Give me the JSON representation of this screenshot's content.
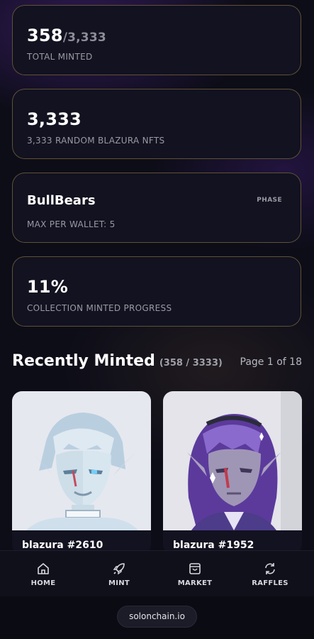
{
  "stats": {
    "total_minted": {
      "value": "358",
      "total": "/3,333",
      "label": "TOTAL MINTED"
    },
    "supply": {
      "value": "3,333",
      "label": "3,333 RANDOM BLAZURA NFTS"
    },
    "phase": {
      "name": "BullBears",
      "badge": "PHASE",
      "label": "MAX PER WALLET: 5"
    },
    "progress": {
      "value": "11%",
      "fraction": 0.11,
      "label": "COLLECTION MINTED PROGRESS"
    }
  },
  "recent": {
    "title": "Recently Minted",
    "count": "(358 / 3333)",
    "page": "Page 1 of 18",
    "items": [
      {
        "label": "blazura #2610",
        "image": "white-haired-elf-portrait"
      },
      {
        "label": "blazura #1952",
        "image": "purple-haired-elf-portrait"
      }
    ]
  },
  "nav": {
    "items": [
      {
        "label": "HOME",
        "icon": "home-icon"
      },
      {
        "label": "MINT",
        "icon": "rocket-icon"
      },
      {
        "label": "MARKET",
        "icon": "shopping-bag-icon"
      },
      {
        "label": "RAFFLES",
        "icon": "refresh-icon"
      }
    ]
  },
  "footer": {
    "link": "solonchain.io"
  },
  "colors": {
    "background": "#0d0d18",
    "card": "#121220",
    "card_border": "#be9f50",
    "accent_purple": "#50248c"
  }
}
